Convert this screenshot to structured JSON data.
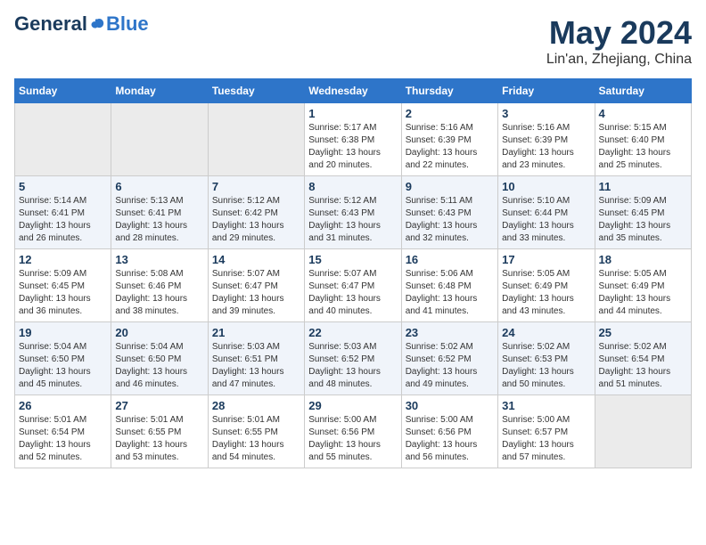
{
  "logo": {
    "general": "General",
    "blue": "Blue",
    "tagline": ""
  },
  "title": "May 2024",
  "subtitle": "Lin'an, Zhejiang, China",
  "days_of_week": [
    "Sunday",
    "Monday",
    "Tuesday",
    "Wednesday",
    "Thursday",
    "Friday",
    "Saturday"
  ],
  "weeks": [
    [
      {
        "day": "",
        "empty": true
      },
      {
        "day": "",
        "empty": true
      },
      {
        "day": "",
        "empty": true
      },
      {
        "day": "1",
        "sunrise": "5:17 AM",
        "sunset": "6:38 PM",
        "daylight": "13 hours and 20 minutes."
      },
      {
        "day": "2",
        "sunrise": "5:16 AM",
        "sunset": "6:39 PM",
        "daylight": "13 hours and 22 minutes."
      },
      {
        "day": "3",
        "sunrise": "5:16 AM",
        "sunset": "6:39 PM",
        "daylight": "13 hours and 23 minutes."
      },
      {
        "day": "4",
        "sunrise": "5:15 AM",
        "sunset": "6:40 PM",
        "daylight": "13 hours and 25 minutes."
      }
    ],
    [
      {
        "day": "5",
        "sunrise": "5:14 AM",
        "sunset": "6:41 PM",
        "daylight": "13 hours and 26 minutes."
      },
      {
        "day": "6",
        "sunrise": "5:13 AM",
        "sunset": "6:41 PM",
        "daylight": "13 hours and 28 minutes."
      },
      {
        "day": "7",
        "sunrise": "5:12 AM",
        "sunset": "6:42 PM",
        "daylight": "13 hours and 29 minutes."
      },
      {
        "day": "8",
        "sunrise": "5:12 AM",
        "sunset": "6:43 PM",
        "daylight": "13 hours and 31 minutes."
      },
      {
        "day": "9",
        "sunrise": "5:11 AM",
        "sunset": "6:43 PM",
        "daylight": "13 hours and 32 minutes."
      },
      {
        "day": "10",
        "sunrise": "5:10 AM",
        "sunset": "6:44 PM",
        "daylight": "13 hours and 33 minutes."
      },
      {
        "day": "11",
        "sunrise": "5:09 AM",
        "sunset": "6:45 PM",
        "daylight": "13 hours and 35 minutes."
      }
    ],
    [
      {
        "day": "12",
        "sunrise": "5:09 AM",
        "sunset": "6:45 PM",
        "daylight": "13 hours and 36 minutes."
      },
      {
        "day": "13",
        "sunrise": "5:08 AM",
        "sunset": "6:46 PM",
        "daylight": "13 hours and 38 minutes."
      },
      {
        "day": "14",
        "sunrise": "5:07 AM",
        "sunset": "6:47 PM",
        "daylight": "13 hours and 39 minutes."
      },
      {
        "day": "15",
        "sunrise": "5:07 AM",
        "sunset": "6:47 PM",
        "daylight": "13 hours and 40 minutes."
      },
      {
        "day": "16",
        "sunrise": "5:06 AM",
        "sunset": "6:48 PM",
        "daylight": "13 hours and 41 minutes."
      },
      {
        "day": "17",
        "sunrise": "5:05 AM",
        "sunset": "6:49 PM",
        "daylight": "13 hours and 43 minutes."
      },
      {
        "day": "18",
        "sunrise": "5:05 AM",
        "sunset": "6:49 PM",
        "daylight": "13 hours and 44 minutes."
      }
    ],
    [
      {
        "day": "19",
        "sunrise": "5:04 AM",
        "sunset": "6:50 PM",
        "daylight": "13 hours and 45 minutes."
      },
      {
        "day": "20",
        "sunrise": "5:04 AM",
        "sunset": "6:50 PM",
        "daylight": "13 hours and 46 minutes."
      },
      {
        "day": "21",
        "sunrise": "5:03 AM",
        "sunset": "6:51 PM",
        "daylight": "13 hours and 47 minutes."
      },
      {
        "day": "22",
        "sunrise": "5:03 AM",
        "sunset": "6:52 PM",
        "daylight": "13 hours and 48 minutes."
      },
      {
        "day": "23",
        "sunrise": "5:02 AM",
        "sunset": "6:52 PM",
        "daylight": "13 hours and 49 minutes."
      },
      {
        "day": "24",
        "sunrise": "5:02 AM",
        "sunset": "6:53 PM",
        "daylight": "13 hours and 50 minutes."
      },
      {
        "day": "25",
        "sunrise": "5:02 AM",
        "sunset": "6:54 PM",
        "daylight": "13 hours and 51 minutes."
      }
    ],
    [
      {
        "day": "26",
        "sunrise": "5:01 AM",
        "sunset": "6:54 PM",
        "daylight": "13 hours and 52 minutes."
      },
      {
        "day": "27",
        "sunrise": "5:01 AM",
        "sunset": "6:55 PM",
        "daylight": "13 hours and 53 minutes."
      },
      {
        "day": "28",
        "sunrise": "5:01 AM",
        "sunset": "6:55 PM",
        "daylight": "13 hours and 54 minutes."
      },
      {
        "day": "29",
        "sunrise": "5:00 AM",
        "sunset": "6:56 PM",
        "daylight": "13 hours and 55 minutes."
      },
      {
        "day": "30",
        "sunrise": "5:00 AM",
        "sunset": "6:56 PM",
        "daylight": "13 hours and 56 minutes."
      },
      {
        "day": "31",
        "sunrise": "5:00 AM",
        "sunset": "6:57 PM",
        "daylight": "13 hours and 57 minutes."
      },
      {
        "day": "",
        "empty": true
      }
    ]
  ]
}
